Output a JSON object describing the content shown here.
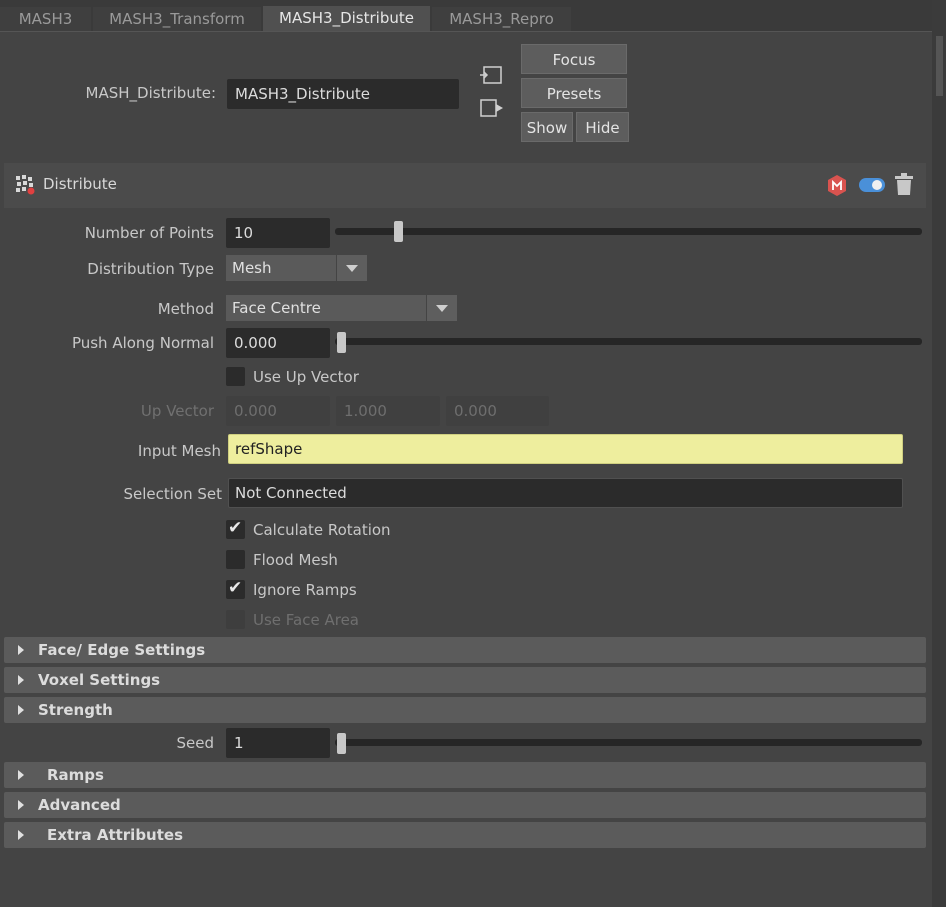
{
  "tabs": [
    "MASH3",
    "MASH3_Transform",
    "MASH3_Distribute",
    "MASH3_Repro"
  ],
  "node": {
    "label": "MASH_Distribute:",
    "value": "MASH3_Distribute",
    "buttons": {
      "focus": "Focus",
      "presets": "Presets",
      "show": "Show",
      "hide": "Hide"
    }
  },
  "header": {
    "title": "Distribute",
    "icons": [
      "distribute-icon",
      "node-icon",
      "toggle-icon",
      "trash-icon"
    ]
  },
  "fields": {
    "number_of_points": {
      "label": "Number of Points",
      "value": "10",
      "slider": 0.1
    },
    "distribution_type": {
      "label": "Distribution Type",
      "value": "Mesh"
    },
    "method": {
      "label": "Method",
      "value": "Face Centre"
    },
    "push_along_normal": {
      "label": "Push Along Normal",
      "value": "0.000",
      "slider": 0.0
    },
    "use_up_vector": {
      "label": "Use Up Vector",
      "checked": false
    },
    "up_vector": {
      "label": "Up Vector",
      "x": "0.000",
      "y": "1.000",
      "z": "0.000"
    },
    "input_mesh": {
      "label": "Input Mesh",
      "value": "refShape"
    },
    "selection_set": {
      "label": "Selection Set",
      "value": "Not Connected"
    },
    "calculate_rotation": {
      "label": "Calculate Rotation",
      "checked": true
    },
    "flood_mesh": {
      "label": "Flood Mesh",
      "checked": false
    },
    "ignore_ramps": {
      "label": "Ignore Ramps",
      "checked": true
    },
    "use_face_area": {
      "label": "Use Face Area",
      "checked": false
    }
  },
  "sections": {
    "face_edge": "Face/ Edge Settings",
    "voxel": "Voxel Settings",
    "strength": "Strength",
    "ramps": "Ramps",
    "advanced": "Advanced",
    "extra": "Extra Attributes"
  },
  "seed": {
    "label": "Seed",
    "value": "1",
    "slider": 0.0
  },
  "colors": {
    "panel": "#444444",
    "field": "#2b2b2b",
    "highlight": "#eeee9e",
    "accent": "#4a90d9"
  }
}
